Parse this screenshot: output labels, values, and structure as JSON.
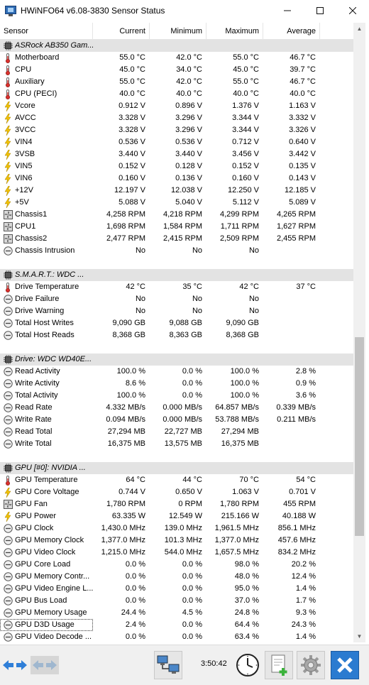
{
  "window": {
    "title": "HWiNFO64 v6.08-3830 Sensor Status"
  },
  "columns": {
    "sensor": "Sensor",
    "current": "Current",
    "minimum": "Minimum",
    "maximum": "Maximum",
    "average": "Average"
  },
  "rows": [
    {
      "type": "group",
      "icon": "chip-icon",
      "name": "ASRock AB350 Gam...",
      "cur": "",
      "min": "",
      "max": "",
      "avg": ""
    },
    {
      "type": "row",
      "icon": "thermometer-icon",
      "name": "Motherboard",
      "cur": "55.0 °C",
      "min": "42.0 °C",
      "max": "55.0 °C",
      "avg": "46.7 °C"
    },
    {
      "type": "row",
      "icon": "thermometer-icon",
      "name": "CPU",
      "cur": "45.0 °C",
      "min": "34.0 °C",
      "max": "45.0 °C",
      "avg": "39.7 °C"
    },
    {
      "type": "row",
      "icon": "thermometer-icon",
      "name": "Auxiliary",
      "cur": "55.0 °C",
      "min": "42.0 °C",
      "max": "55.0 °C",
      "avg": "46.7 °C"
    },
    {
      "type": "row",
      "icon": "thermometer-icon",
      "name": "CPU (PECI)",
      "cur": "40.0 °C",
      "min": "40.0 °C",
      "max": "40.0 °C",
      "avg": "40.0 °C"
    },
    {
      "type": "row",
      "icon": "lightning-icon",
      "name": "Vcore",
      "cur": "0.912 V",
      "min": "0.896 V",
      "max": "1.376 V",
      "avg": "1.163 V"
    },
    {
      "type": "row",
      "icon": "lightning-icon",
      "name": "AVCC",
      "cur": "3.328 V",
      "min": "3.296 V",
      "max": "3.344 V",
      "avg": "3.332 V"
    },
    {
      "type": "row",
      "icon": "lightning-icon",
      "name": "3VCC",
      "cur": "3.328 V",
      "min": "3.296 V",
      "max": "3.344 V",
      "avg": "3.326 V"
    },
    {
      "type": "row",
      "icon": "lightning-icon",
      "name": "VIN4",
      "cur": "0.536 V",
      "min": "0.536 V",
      "max": "0.712 V",
      "avg": "0.640 V"
    },
    {
      "type": "row",
      "icon": "lightning-icon",
      "name": "3VSB",
      "cur": "3.440 V",
      "min": "3.440 V",
      "max": "3.456 V",
      "avg": "3.442 V"
    },
    {
      "type": "row",
      "icon": "lightning-icon",
      "name": "VIN5",
      "cur": "0.152 V",
      "min": "0.128 V",
      "max": "0.152 V",
      "avg": "0.135 V"
    },
    {
      "type": "row",
      "icon": "lightning-icon",
      "name": "VIN6",
      "cur": "0.160 V",
      "min": "0.136 V",
      "max": "0.160 V",
      "avg": "0.143 V"
    },
    {
      "type": "row",
      "icon": "lightning-icon",
      "name": "+12V",
      "cur": "12.197 V",
      "min": "12.038 V",
      "max": "12.250 V",
      "avg": "12.185 V"
    },
    {
      "type": "row",
      "icon": "lightning-icon",
      "name": "+5V",
      "cur": "5.088 V",
      "min": "5.040 V",
      "max": "5.112 V",
      "avg": "5.089 V"
    },
    {
      "type": "row",
      "icon": "fan-icon",
      "name": "Chassis1",
      "cur": "4,258 RPM",
      "min": "4,218 RPM",
      "max": "4,299 RPM",
      "avg": "4,265 RPM"
    },
    {
      "type": "row",
      "icon": "fan-icon",
      "name": "CPU1",
      "cur": "1,698 RPM",
      "min": "1,584 RPM",
      "max": "1,711 RPM",
      "avg": "1,627 RPM"
    },
    {
      "type": "row",
      "icon": "fan-icon",
      "name": "Chassis2",
      "cur": "2,477 RPM",
      "min": "2,415 RPM",
      "max": "2,509 RPM",
      "avg": "2,455 RPM"
    },
    {
      "type": "row",
      "icon": "gauge-icon",
      "name": "Chassis Intrusion",
      "cur": "No",
      "min": "No",
      "max": "No",
      "avg": ""
    },
    {
      "type": "gap"
    },
    {
      "type": "group",
      "icon": "chip-icon",
      "name": "S.M.A.R.T.: WDC ...",
      "cur": "",
      "min": "",
      "max": "",
      "avg": ""
    },
    {
      "type": "row",
      "icon": "thermometer-icon",
      "name": "Drive Temperature",
      "cur": "42 °C",
      "min": "35 °C",
      "max": "42 °C",
      "avg": "37 °C"
    },
    {
      "type": "row",
      "icon": "gauge-icon",
      "name": "Drive Failure",
      "cur": "No",
      "min": "No",
      "max": "No",
      "avg": ""
    },
    {
      "type": "row",
      "icon": "gauge-icon",
      "name": "Drive Warning",
      "cur": "No",
      "min": "No",
      "max": "No",
      "avg": ""
    },
    {
      "type": "row",
      "icon": "gauge-icon",
      "name": "Total Host Writes",
      "cur": "9,090 GB",
      "min": "9,088 GB",
      "max": "9,090 GB",
      "avg": ""
    },
    {
      "type": "row",
      "icon": "gauge-icon",
      "name": "Total Host Reads",
      "cur": "8,368 GB",
      "min": "8,363 GB",
      "max": "8,368 GB",
      "avg": ""
    },
    {
      "type": "gap"
    },
    {
      "type": "group",
      "icon": "chip-icon",
      "name": "Drive: WDC WD40E...",
      "cur": "",
      "min": "",
      "max": "",
      "avg": ""
    },
    {
      "type": "row",
      "icon": "gauge-icon",
      "name": "Read Activity",
      "cur": "100.0 %",
      "min": "0.0 %",
      "max": "100.0 %",
      "avg": "2.8 %"
    },
    {
      "type": "row",
      "icon": "gauge-icon",
      "name": "Write Activity",
      "cur": "8.6 %",
      "min": "0.0 %",
      "max": "100.0 %",
      "avg": "0.9 %"
    },
    {
      "type": "row",
      "icon": "gauge-icon",
      "name": "Total Activity",
      "cur": "100.0 %",
      "min": "0.0 %",
      "max": "100.0 %",
      "avg": "3.6 %"
    },
    {
      "type": "row",
      "icon": "gauge-icon",
      "name": "Read Rate",
      "cur": "4.332 MB/s",
      "min": "0.000 MB/s",
      "max": "64.857 MB/s",
      "avg": "0.339 MB/s"
    },
    {
      "type": "row",
      "icon": "gauge-icon",
      "name": "Write Rate",
      "cur": "0.094 MB/s",
      "min": "0.000 MB/s",
      "max": "53.788 MB/s",
      "avg": "0.211 MB/s"
    },
    {
      "type": "row",
      "icon": "gauge-icon",
      "name": "Read Total",
      "cur": "27,294 MB",
      "min": "22,727 MB",
      "max": "27,294 MB",
      "avg": ""
    },
    {
      "type": "row",
      "icon": "gauge-icon",
      "name": "Write Total",
      "cur": "16,375 MB",
      "min": "13,575 MB",
      "max": "16,375 MB",
      "avg": ""
    },
    {
      "type": "gap"
    },
    {
      "type": "group",
      "icon": "chip-icon",
      "name": "GPU [#0]: NVIDIA ...",
      "cur": "",
      "min": "",
      "max": "",
      "avg": ""
    },
    {
      "type": "row",
      "icon": "thermometer-icon",
      "name": "GPU Temperature",
      "cur": "64 °C",
      "min": "44 °C",
      "max": "70 °C",
      "avg": "54 °C"
    },
    {
      "type": "row",
      "icon": "lightning-icon",
      "name": "GPU Core Voltage",
      "cur": "0.744 V",
      "min": "0.650 V",
      "max": "1.063 V",
      "avg": "0.701 V"
    },
    {
      "type": "row",
      "icon": "fan-icon",
      "name": "GPU Fan",
      "cur": "1,780 RPM",
      "min": "0 RPM",
      "max": "1,780 RPM",
      "avg": "455 RPM"
    },
    {
      "type": "row",
      "icon": "lightning-icon",
      "name": "GPU Power",
      "cur": "63.335 W",
      "min": "12.549 W",
      "max": "215.166 W",
      "avg": "40.188 W"
    },
    {
      "type": "row",
      "icon": "gauge-icon",
      "name": "GPU Clock",
      "cur": "1,430.0 MHz",
      "min": "139.0 MHz",
      "max": "1,961.5 MHz",
      "avg": "856.1 MHz"
    },
    {
      "type": "row",
      "icon": "gauge-icon",
      "name": "GPU Memory Clock",
      "cur": "1,377.0 MHz",
      "min": "101.3 MHz",
      "max": "1,377.0 MHz",
      "avg": "457.6 MHz"
    },
    {
      "type": "row",
      "icon": "gauge-icon",
      "name": "GPU Video Clock",
      "cur": "1,215.0 MHz",
      "min": "544.0 MHz",
      "max": "1,657.5 MHz",
      "avg": "834.2 MHz"
    },
    {
      "type": "row",
      "icon": "gauge-icon",
      "name": "GPU Core Load",
      "cur": "0.0 %",
      "min": "0.0 %",
      "max": "98.0 %",
      "avg": "20.2 %"
    },
    {
      "type": "row",
      "icon": "gauge-icon",
      "name": "GPU Memory Contr...",
      "cur": "0.0 %",
      "min": "0.0 %",
      "max": "48.0 %",
      "avg": "12.4 %"
    },
    {
      "type": "row",
      "icon": "gauge-icon",
      "name": "GPU Video Engine L...",
      "cur": "0.0 %",
      "min": "0.0 %",
      "max": "95.0 %",
      "avg": "1.4 %"
    },
    {
      "type": "row",
      "icon": "gauge-icon",
      "name": "GPU Bus Load",
      "cur": "0.0 %",
      "min": "0.0 %",
      "max": "37.0 %",
      "avg": "1.7 %"
    },
    {
      "type": "row",
      "icon": "gauge-icon",
      "name": "GPU Memory Usage",
      "cur": "24.4 %",
      "min": "4.5 %",
      "max": "24.8 %",
      "avg": "9.3 %"
    },
    {
      "type": "row",
      "icon": "gauge-icon",
      "name": "GPU D3D Usage",
      "cur": "2.4 %",
      "min": "0.0 %",
      "max": "64.4 %",
      "avg": "24.3 %",
      "selected": true
    },
    {
      "type": "row",
      "icon": "gauge-icon",
      "name": "GPU Video Decode ...",
      "cur": "0.0 %",
      "min": "0.0 %",
      "max": "63.4 %",
      "avg": "1.4 %"
    }
  ],
  "toolbar": {
    "time": "3:50:42",
    "icons": [
      "arrows-left-right-icon",
      "arrows-left-right-disabled-icon",
      "network-computers-icon",
      "clock-icon",
      "add-report-icon",
      "settings-gear-icon",
      "close-x-icon"
    ]
  },
  "colors": {
    "group_bg": "#e3e3e3",
    "accent": "#1f6fc5",
    "lightning": "#f2c200",
    "close_btn": "#2b7bd0"
  }
}
